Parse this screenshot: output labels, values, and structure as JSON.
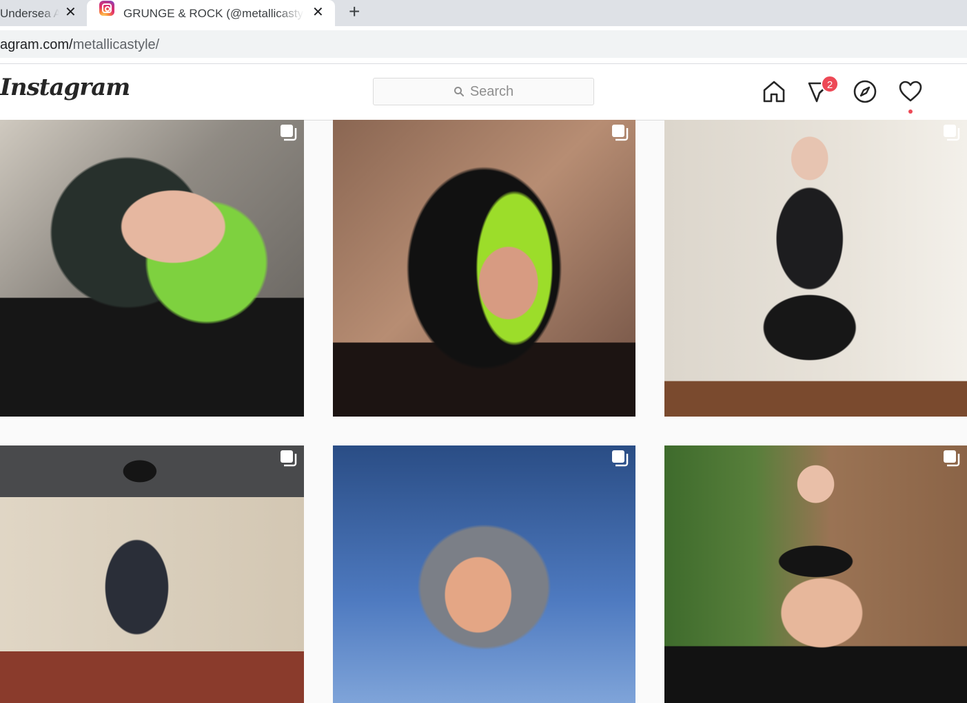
{
  "browser": {
    "tabs": [
      {
        "title": "Undersea A",
        "active": false
      },
      {
        "title": "GRUNGE & ROCK (@metallicasty",
        "active": true
      }
    ],
    "new_tab_label": "+",
    "close_label": "✕",
    "url_host": "agram.com/",
    "url_path": "metallicastyle/"
  },
  "instagram": {
    "logo": "Instagram",
    "search_placeholder": "Search",
    "nav": {
      "direct_badge": "2"
    },
    "posts": [
      {
        "multi": true
      },
      {
        "multi": true
      },
      {
        "multi": true
      },
      {
        "multi": true
      },
      {
        "multi": true
      },
      {
        "multi": true
      }
    ]
  },
  "colors": {
    "badge": "#ed4956",
    "text": "#262626",
    "border": "#dbdbdb"
  }
}
